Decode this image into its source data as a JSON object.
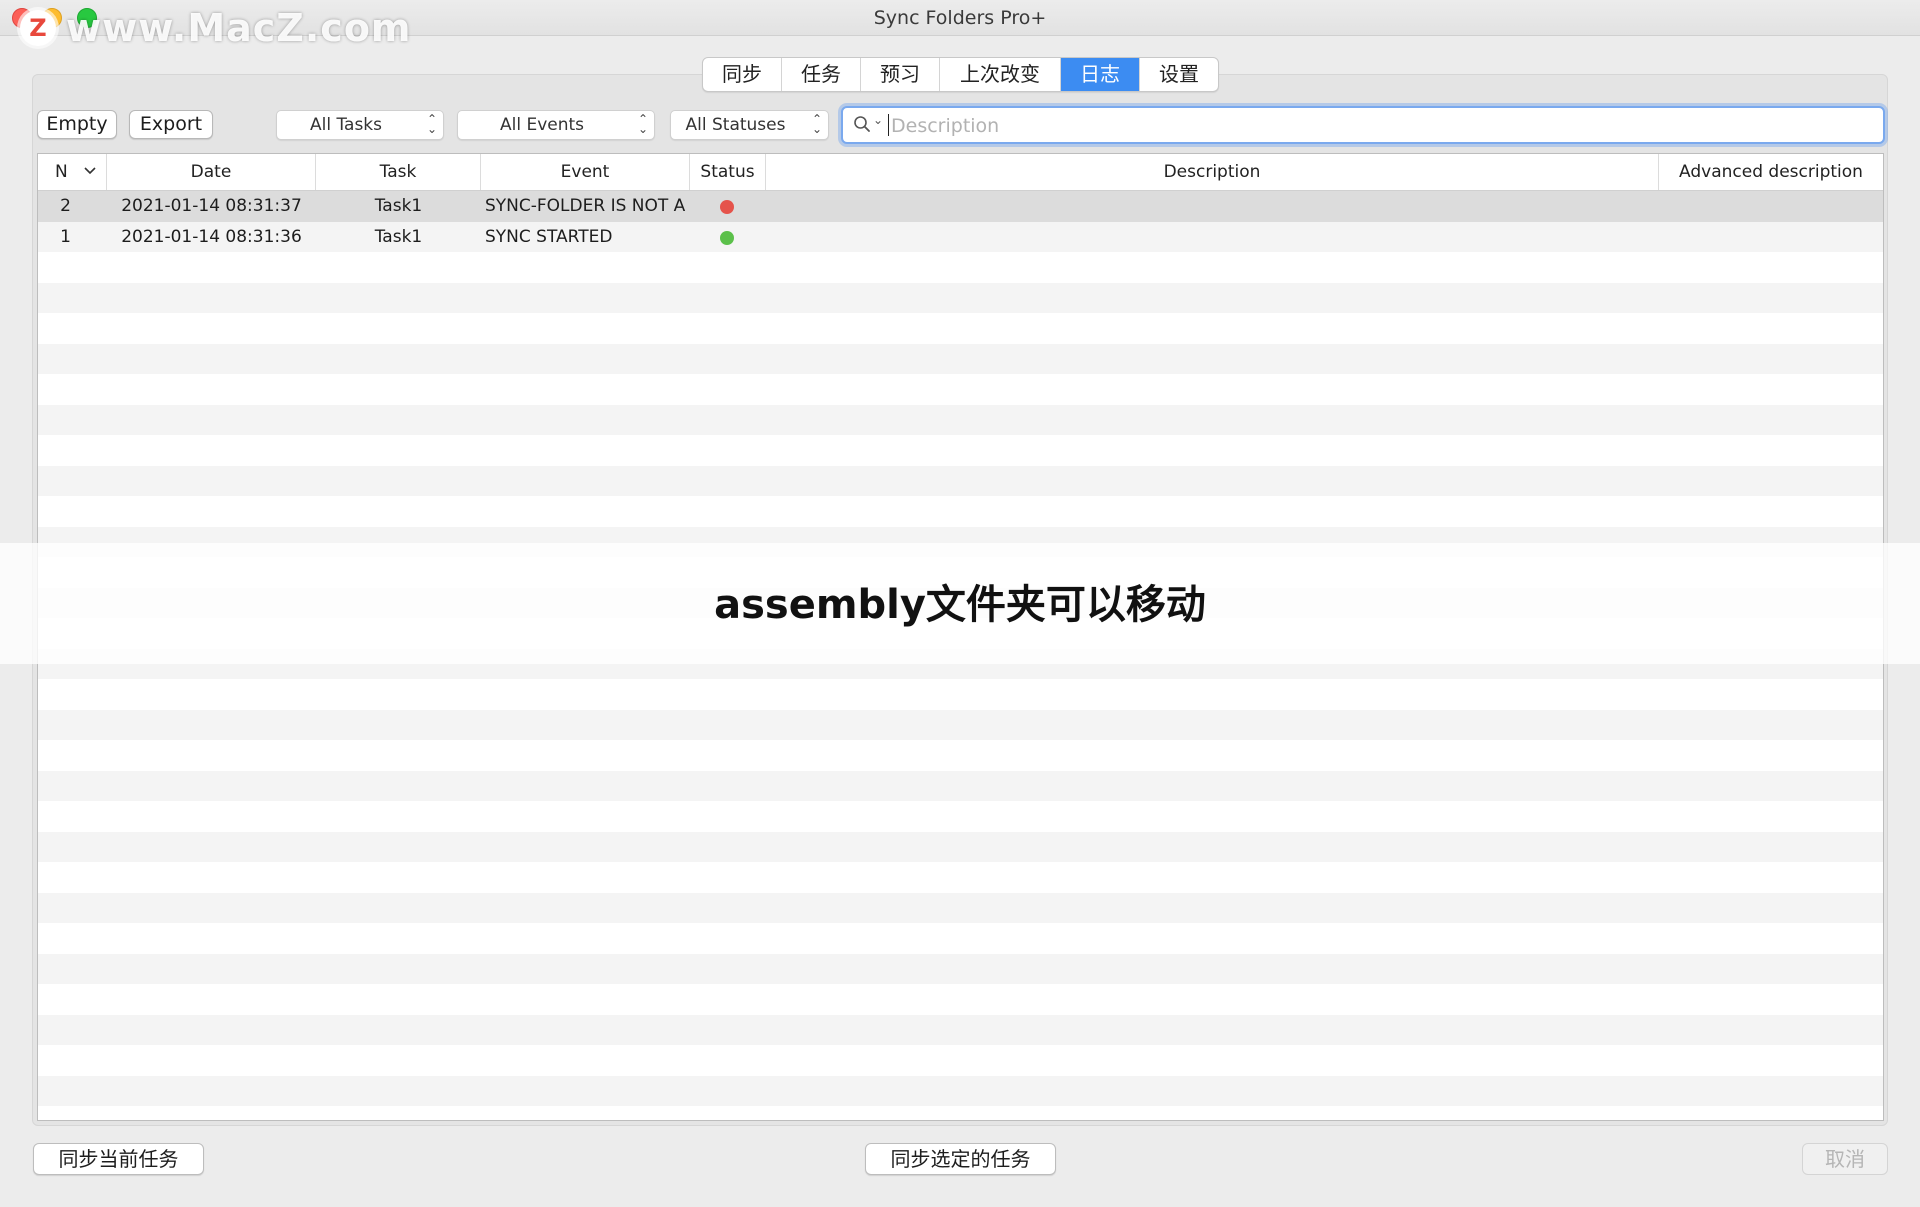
{
  "window": {
    "title": "Sync Folders Pro+",
    "watermark": "www.MacZ.com",
    "watermark_logo": "Z"
  },
  "tabs": [
    {
      "label": "同步"
    },
    {
      "label": "任务"
    },
    {
      "label": "预习"
    },
    {
      "label": "上次改变"
    },
    {
      "label": "日志",
      "active": true
    },
    {
      "label": "设置"
    }
  ],
  "toolbar": {
    "empty_label": "Empty",
    "export_label": "Export",
    "task_filter": "All Tasks",
    "event_filter": "All Events",
    "status_filter": "All Statuses",
    "search_placeholder": "Description",
    "search_icon": "magnifier-icon"
  },
  "table": {
    "columns": [
      "N",
      "Date",
      "Task",
      "Event",
      "Status",
      "Description",
      "Advanced description"
    ],
    "sort_indicator": "chevron-down-icon",
    "rows": [
      {
        "n": "2",
        "date": "2021-01-14 08:31:37",
        "task": "Task1",
        "event": "SYNC-FOLDER IS NOT A",
        "status": "error",
        "status_color": "#e5534b",
        "description": "",
        "advanced": ""
      },
      {
        "n": "1",
        "date": "2021-01-14 08:31:36",
        "task": "Task1",
        "event": "SYNC STARTED",
        "status": "ok",
        "status_color": "#5bc04a",
        "description": "",
        "advanced": ""
      }
    ]
  },
  "overlay": {
    "caption": "assembly文件夹可以移动"
  },
  "footer": {
    "sync_current_label": "同步当前任务",
    "sync_selected_label": "同步选定的任务",
    "cancel_label": "取消"
  },
  "colors": {
    "accent": "#3c8cf2",
    "error": "#e5534b",
    "ok": "#5bc04a"
  }
}
